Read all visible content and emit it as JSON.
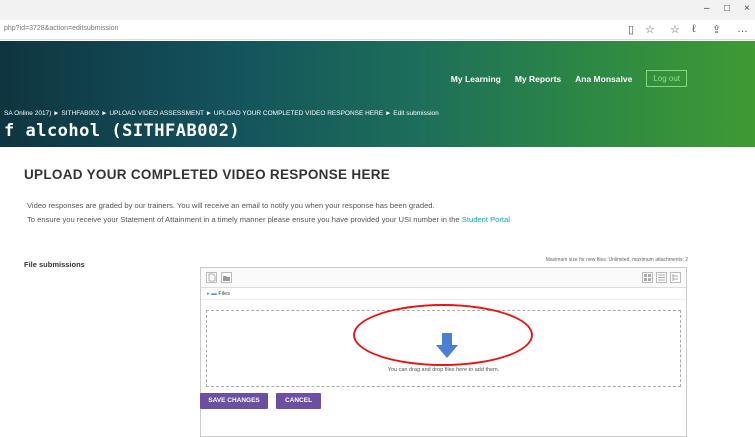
{
  "browser": {
    "window_controls": [
      "–",
      "□",
      "×"
    ],
    "url": "php?id=3728&action=editsubmission",
    "toolbar_icons": [
      "reader-icon",
      "star-icon",
      "favorites-icon",
      "pen-icon",
      "share-icon",
      "more-icon"
    ],
    "toolbar_glyphs": [
      "▯",
      "☆",
      "☆",
      "ℓ",
      "⇪",
      "…"
    ]
  },
  "header": {
    "nav": [
      "My Learning",
      "My Reports",
      "Ana Monsalve"
    ],
    "logout_label": "Log out",
    "breadcrumb": "SA Online 2017) ► SITHFAB002 ► UPLOAD VIDEO ASSESSMENT ► UPLOAD YOUR COMPLETED VIDEO RESPONSE HERE ► Edit submission",
    "course_title": "f alcohol (SITHFAB002)"
  },
  "main": {
    "title": "UPLOAD YOUR COMPLETED VIDEO RESPONSE HERE",
    "note1": "Video responses are graded by our trainers. You will receive an email to notify you when your response has been graded.",
    "note2_prefix": "To ensure you receive your Statement of Attainment in a timely manner please ensure you have provided your USI number in the",
    "note2_link": "Student Portal",
    "file_label": "File submissions",
    "max_size": "Maximum size for new files: Unlimited, maximum attachments: 2",
    "folder_label": "Files",
    "drop_text": "You can drag and drop files here to add them.",
    "save_label": "SAVE CHANGES",
    "cancel_label": "CANCEL"
  },
  "colors": {
    "button": "#6c4fa0",
    "link": "#19a3b5",
    "highlight_circle": "#e31515",
    "arrow": "#4a7fd4"
  }
}
